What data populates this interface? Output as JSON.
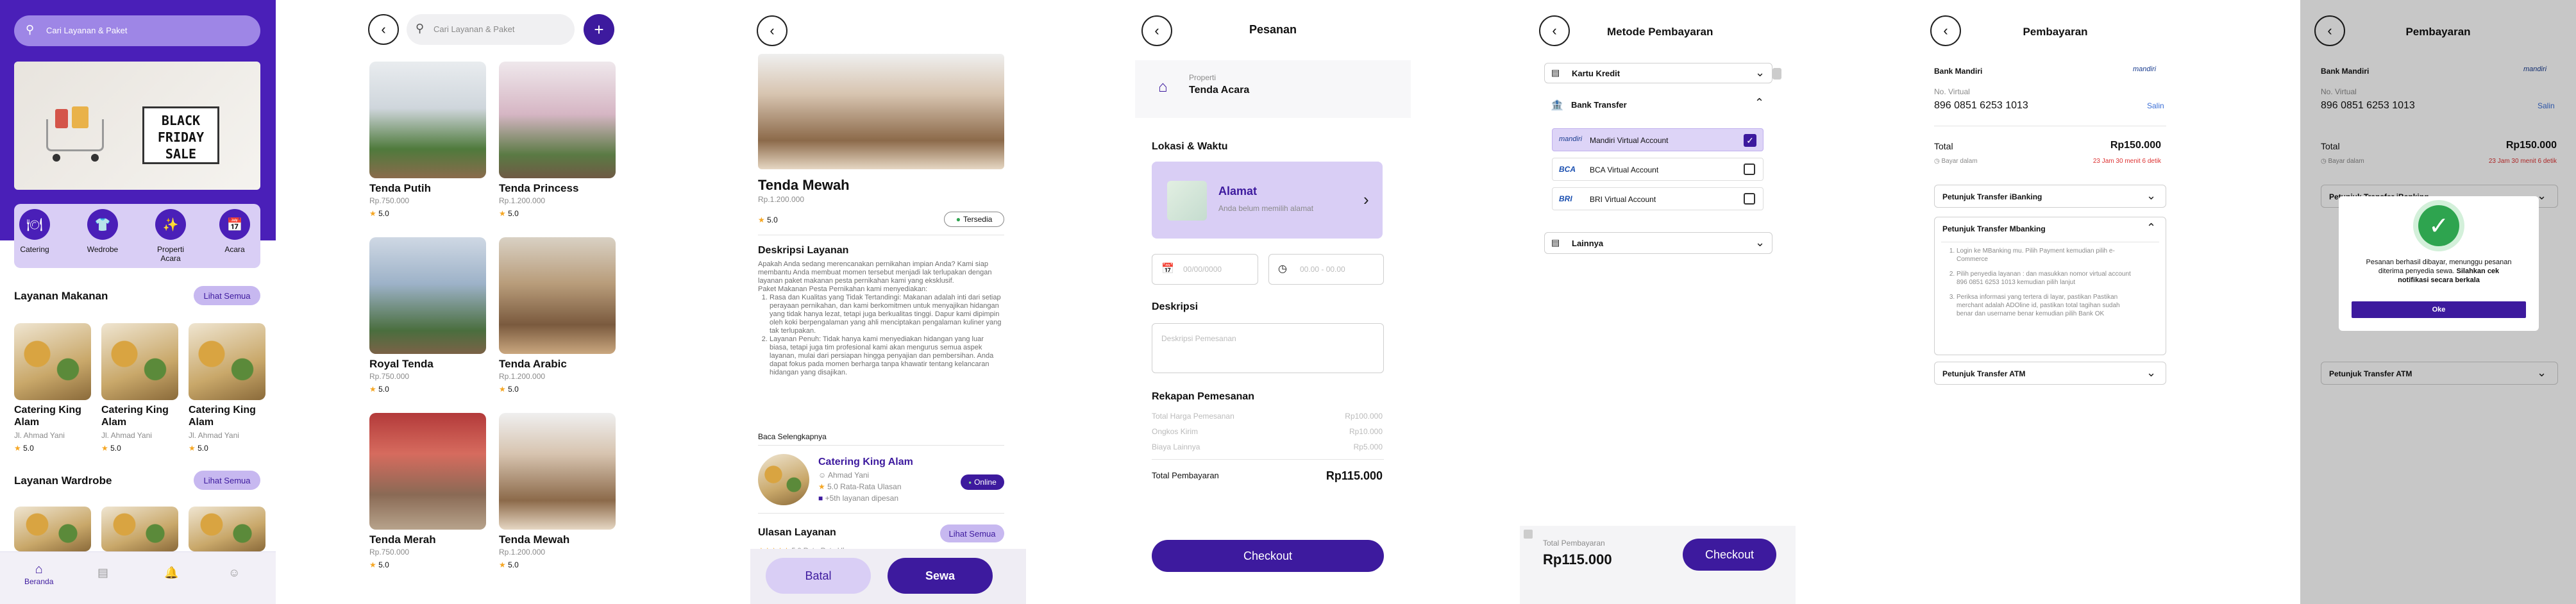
{
  "s1": {
    "search_placeholder": "Cari Layanan & Paket",
    "banner": {
      "line1": "BLACK",
      "line2": "FRIDAY",
      "line3": "SALE"
    },
    "categories": [
      {
        "label": "Catering",
        "icon": "catering-icon"
      },
      {
        "label": "Wedrobe",
        "icon": "wardrobe-icon"
      },
      {
        "label": "Properti Acara",
        "icon": "property-icon"
      },
      {
        "label": "Acara",
        "icon": "event-icon"
      }
    ],
    "section_food": "Layanan Makanan",
    "section_wardrobe": "Layanan Wardrobe",
    "see_all": "Lihat Semua",
    "food_items": [
      {
        "name": "Catering King Alam",
        "addr": "Jl. Ahmad Yani",
        "rating": "5.0"
      },
      {
        "name": "Catering King Alam",
        "addr": "Jl. Ahmad Yani",
        "rating": "5.0"
      },
      {
        "name": "Catering King Alam",
        "addr": "Jl. Ahmad Yani",
        "rating": "5.0"
      }
    ],
    "nav_home": "Beranda"
  },
  "s2": {
    "search_placeholder": "Cari Layanan & Paket",
    "add": "+",
    "items": [
      {
        "name": "Tenda Putih",
        "price": "Rp.750.000",
        "rating": "5.0"
      },
      {
        "name": "Tenda Princess",
        "price": "Rp.1.200.000",
        "rating": "5.0"
      },
      {
        "name": "Royal Tenda",
        "price": "Rp.750.000",
        "rating": "5.0"
      },
      {
        "name": "Tenda Arabic",
        "price": "Rp.1.200.000",
        "rating": "5.0"
      },
      {
        "name": "Tenda Merah",
        "price": "Rp.750.000",
        "rating": "5.0"
      },
      {
        "name": "Tenda Mewah",
        "price": "Rp.1.200.000",
        "rating": "5.0"
      }
    ]
  },
  "s3": {
    "title": "Tenda Mewah",
    "price": "Rp.1.200.000",
    "rating": "5.0",
    "status": "Tersedia",
    "desc_title": "Deskripsi Layanan",
    "desc_intro": "Apakah Anda sedang merencanakan pernikahan impian Anda? Kami siap membantu Anda membuat momen tersebut menjadi lak terlupakan dengan layanan paket makanan pesta pernikahan kami yang eksklusif.",
    "desc_intro2": "Paket Makanan Pesta Pernikahan kami menyediakan:",
    "desc_points": [
      "Rasa dan Kualitas yang Tidak Tertandingi: Makanan adalah inti dari setiap perayaan pernikahan, dan kami berkomitmen untuk menyajikan hidangan yang tidak hanya lezat, tetapi juga berkualitas tinggi. Dapur kami dipimpin oleh koki berpengalaman yang ahli menciptakan pengalaman kuliner yang tak terlupakan.",
      "Layanan Penuh: Tidak hanya kami menyediakan hidangan yang luar biasa, tetapi juga tim profesional kami akan mengurus semua aspek layanan, mulai dari persiapan hingga penyajian dan pembersihan. Anda dapat fokus pada momen berharga tanpa khawatir tentang kelancaran hidangan yang disajikan."
    ],
    "read_more": "Baca Selengkapnya",
    "vendor": {
      "name": "Catering King Alam",
      "addr": "Ahmad Yani",
      "rating": "5.0 Rata-Rata Ulasan",
      "services": "+5th layanan dipesan",
      "online": "Online"
    },
    "reviews_title": "Ulasan Layanan",
    "see_all": "Lihat Semua",
    "review_count": "5.0 Rata-Rata Ulasan",
    "cancel": "Batal",
    "rent": "Sewa"
  },
  "s4": {
    "title": "Pesanan",
    "property_label": "Properti",
    "property_value": "Tenda Acara",
    "loc_title": "Lokasi & Waktu",
    "address_title": "Alamat",
    "address_sub": "Anda belum memilih alamat",
    "date_placeholder": "00/00/0000",
    "time_placeholder": "00.00 - 00.00",
    "desc_title": "Deskripsi",
    "desc_placeholder": "Deskripsi Pemesanan",
    "summary_title": "Rekapan Pemesanan",
    "rows": [
      {
        "label": "Total Harga Pemesanan",
        "value": "Rp100.000"
      },
      {
        "label": "Ongkos Kirim",
        "value": "Rp10.000"
      },
      {
        "label": "Biaya Lainnya",
        "value": "Rp5.000"
      }
    ],
    "total_label": "Total Pembayaran",
    "total_value": "Rp115.000",
    "checkout": "Checkout"
  },
  "s5": {
    "title": "Metode Pembayaran",
    "credit": "Kartu Kredit",
    "bank": "Bank Transfer",
    "options": [
      {
        "label": "Mandiri Virtual Account",
        "logo": "mandiri",
        "checked": true
      },
      {
        "label": "BCA Virtual Account",
        "logo": "BCA",
        "checked": false
      },
      {
        "label": "BRI Virtual Account",
        "logo": "BRI",
        "checked": false
      }
    ],
    "other": "Lainnya",
    "total_label": "Total Pembayaran",
    "total_value": "Rp115.000",
    "checkout": "Checkout"
  },
  "s6": {
    "title": "Pembayaran",
    "bank_name": "Bank Mandiri",
    "bank_logo": "mandiri",
    "va_label": "No. Virtual",
    "va_number": "896 0851 6253 1013",
    "copy": "Salin",
    "total_label": "Total",
    "total_value": "Rp150.000",
    "due_label": "Bayar dalam",
    "due_value": "23 Jam 30 menit 6 detik",
    "guide_ibanking": "Petunjuk Transfer iBanking",
    "guide_mbanking": "Petunjuk Transfer Mbanking",
    "steps": [
      "Login ke MBanking mu. Pilih Payment kemudian pilih e-Commerce",
      "Pilih penyedia layanan : dan masukkan nomor virtual account 896 0851 6253 1013 kemudian pilih lanjut",
      "Periksa informasi yang tertera di layar, pastikan Pastikan merchant adalah ADOline id, pastikan total tagihan sudah benar dan username benar kemudian pilih Bank OK"
    ],
    "guide_atm": "Petunjuk Transfer ATM"
  },
  "s7": {
    "title": "Pembayaran",
    "bank_name": "Bank Mandiri",
    "va_label": "No. Virtual",
    "va_number": "896 0851 6253 1013",
    "copy": "Salin",
    "total_label": "Total",
    "total_value": "Rp150.000",
    "due_label": "Bayar dalam",
    "due_value": "23 Jam 30 menit 6 detik",
    "guide_ibanking": "Petunjuk Transfer iBanking",
    "guide_atm": "Petunjuk Transfer ATM",
    "modal_text1": "Pesanan berhasil dibayar, menunggu pesanan diterima penyedia sewa.",
    "modal_text2": "Silahkan cek notifikasi secara berkala",
    "ok": "Oke"
  },
  "colors": {
    "primary": "#3d1a9e",
    "accent": "#7b3fd6",
    "light": "#c7b8f0"
  }
}
